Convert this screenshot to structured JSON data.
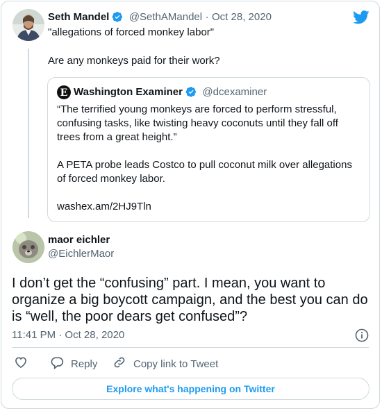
{
  "tweet_parent": {
    "author_name": "Seth Mandel",
    "handle": "@SethAMandel",
    "separator": "·",
    "date": "Oct 28, 2020",
    "text_line1": "\"allegations of forced monkey labor\"",
    "text_line2": "Are any monkeys paid for their work?",
    "avatar_icon": "person-photo"
  },
  "quote": {
    "author_name": "Washington Examiner",
    "handle": "@dcexaminer",
    "logo_icon": "washington-examiner-logo",
    "line1": "“The terrified young monkeys are forced to perform stressful,",
    "line2": "confusing tasks, like twisting heavy coconuts until they fall off",
    "line3": "trees from a great height.”",
    "line4": "A PETA probe leads Costco to pull coconut milk over allegations",
    "line5": "of forced monkey labor.",
    "link": "washex.am/2HJ9Tln"
  },
  "tweet_main": {
    "author_name": "maor eichler",
    "handle": "@EichlerMaor",
    "avatar_icon": "dog-photo",
    "line1": "I don’t get the “confusing” part. I mean, you want to",
    "line2": "organize a big boycott campaign, and the best you can do",
    "line3": "is “well, the poor dears get confused”?",
    "time": "11:41 PM · Oct 28, 2020"
  },
  "actions": {
    "reply_label": "Reply",
    "copy_label": "Copy link to Tweet"
  },
  "explore_label": "Explore what's happening on Twitter",
  "colors": {
    "accent": "#1d9bf0",
    "muted": "#536471",
    "border": "#cfd9de"
  }
}
